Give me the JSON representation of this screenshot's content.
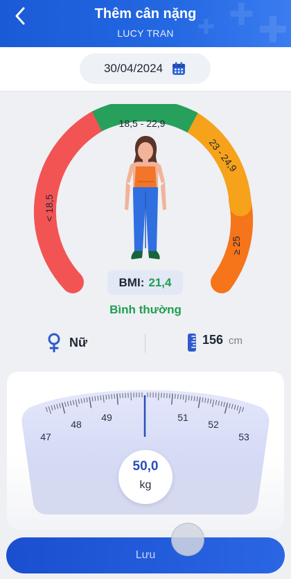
{
  "header": {
    "title": "Thêm cân nặng",
    "subtitle": "LUCY TRAN",
    "back_icon": "chevron-left-icon"
  },
  "date": {
    "value": "30/04/2024",
    "icon": "calendar-icon"
  },
  "gauge": {
    "segments": [
      {
        "label": "< 18,5",
        "color": "#f25454"
      },
      {
        "label": "18,5 - 22,9",
        "color": "#26a05a"
      },
      {
        "label": "23 - 24,9",
        "color": "#f6a21a"
      },
      {
        "label": "≥ 25",
        "color": "#f6741a"
      }
    ]
  },
  "bmi": {
    "label": "BMI:",
    "value": "21,4",
    "status": "Bình thường",
    "status_color": "#1f9e52"
  },
  "profile": {
    "gender": "Nữ",
    "gender_icon": "female-icon",
    "height_value": "156",
    "height_unit": "cm",
    "height_icon": "ruler-icon"
  },
  "scale": {
    "ticks": [
      "47",
      "48",
      "49",
      "51",
      "52",
      "53"
    ],
    "selected_value": "50,0",
    "unit": "kg",
    "accent": "#2a4db8"
  },
  "actions": {
    "save_label": "Lưu"
  }
}
